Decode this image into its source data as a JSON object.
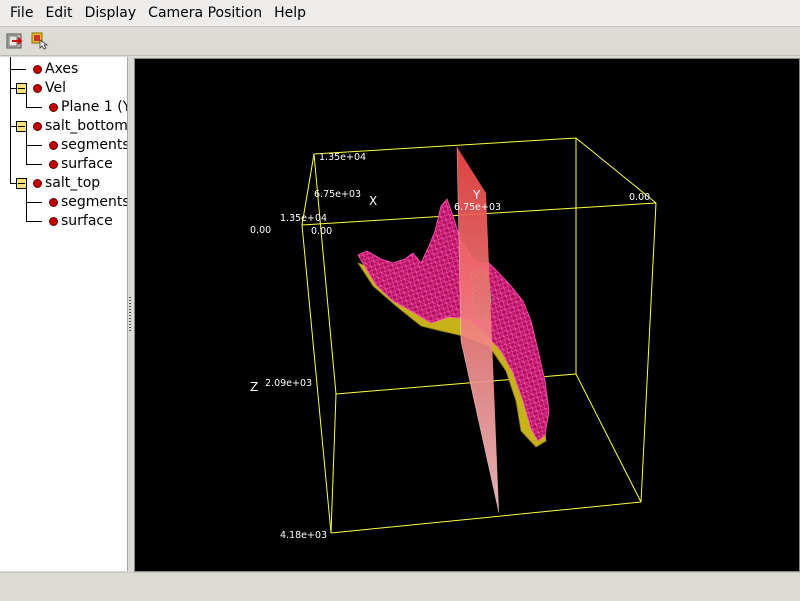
{
  "menu": {
    "file": "File",
    "edit": "Edit",
    "display": "Display",
    "camera_position": "Camera Position",
    "help": "Help"
  },
  "toolbar": {
    "icons": [
      "exit-icon",
      "pick-icon"
    ]
  },
  "tree": {
    "axes": "Axes",
    "vel": "Vel",
    "plane1": "Plane 1 (Y",
    "salt_bottom": "salt_bottom",
    "salt_bottom_segments": "segments",
    "salt_bottom_surface": "surface",
    "salt_top": "salt_top",
    "salt_top_segments": "segments",
    "salt_top_surface": "surface"
  },
  "viewport": {
    "axis_labels": {
      "x": "X",
      "y": "Y",
      "z": "Z"
    },
    "tick_labels": {
      "top_back_left": "1.35e+04",
      "x_mid": "6.75e+03",
      "y_mid": "6.75e+03",
      "y_end": "0.00",
      "top_front_left": "1.35e+04",
      "origin_left": "0.00",
      "origin_right": "0.00",
      "z_mid": "2.09e+03",
      "z_bottom": "4.18e+03"
    },
    "colors": {
      "background": "#000000",
      "bbox": "#ffff40",
      "surface_magenta": "#d0207a",
      "surface_yellow": "#c8b21a",
      "plane": "#f07070"
    }
  }
}
